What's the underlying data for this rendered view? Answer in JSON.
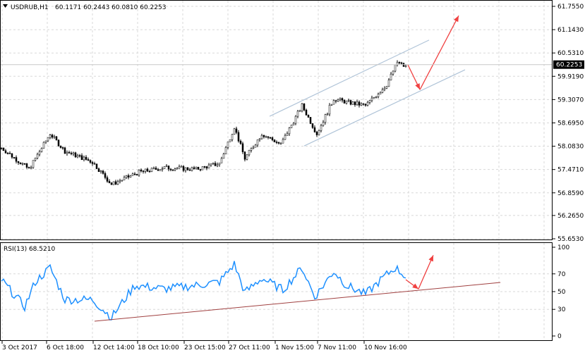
{
  "header": {
    "symbol": "USDRUB,H1",
    "ohlc": "60.1171 60.2443 60.0810 60.2253"
  },
  "chart_data": [
    {
      "type": "candlestick",
      "title": "USDRUB,H1",
      "ylim": [
        55.653,
        61.755
      ],
      "y_ticks": [
        "61.7550",
        "61.1430",
        "60.5310",
        "59.9190",
        "59.3070",
        "58.6950",
        "58.0830",
        "57.4710",
        "56.8590",
        "56.2650",
        "55.6530"
      ],
      "y_tick_values": [
        61.755,
        61.143,
        60.531,
        59.919,
        59.307,
        58.695,
        58.083,
        57.471,
        56.859,
        56.265,
        55.653
      ],
      "current_price": "60.2253",
      "current_value": 60.2253,
      "x_labels": [
        "3 Oct 2017",
        "6 Oct 18:00",
        "12 Oct 14:00",
        "18 Oct 10:00",
        "23 Oct 15:00",
        "27 Oct 11:00",
        "1 Nov 15:00",
        "7 Nov 11:00",
        "10 Nov 16:00"
      ],
      "x_label_bars": [
        0,
        21,
        43,
        64,
        86,
        107,
        129,
        149,
        171
      ],
      "close_keypoints": [
        [
          0,
          58.04
        ],
        [
          13,
          57.48
        ],
        [
          23,
          58.41
        ],
        [
          30,
          57.95
        ],
        [
          43,
          57.67
        ],
        [
          52,
          57.08
        ],
        [
          65,
          57.4
        ],
        [
          77,
          57.52
        ],
        [
          92,
          57.48
        ],
        [
          103,
          57.63
        ],
        [
          110,
          58.59
        ],
        [
          115,
          57.76
        ],
        [
          123,
          58.41
        ],
        [
          132,
          58.13
        ],
        [
          142,
          59.15
        ],
        [
          149,
          58.41
        ],
        [
          157,
          59.33
        ],
        [
          163,
          59.24
        ],
        [
          172,
          59.15
        ],
        [
          182,
          59.7
        ],
        [
          187,
          60.29
        ],
        [
          191,
          60.16
        ]
      ],
      "channel_lines": [
        [
          [
            126.7,
            58.87
          ],
          [
            202,
            60.87
          ]
        ],
        [
          [
            143,
            58.09
          ],
          [
            219,
            60.09
          ]
        ]
      ],
      "arrows": [
        [
          [
            192,
            60.22
          ],
          [
            197.7,
            59.57
          ]
        ],
        [
          [
            197.7,
            59.57
          ],
          [
            216,
            61.51
          ]
        ]
      ]
    },
    {
      "type": "line",
      "title": "RSI(13) 68.5210",
      "ylim": [
        0,
        100
      ],
      "y_ticks": [
        "100",
        "70",
        "50",
        "30",
        "0"
      ],
      "y_tick_values": [
        100,
        70,
        50,
        30,
        0
      ],
      "keypoints": [
        [
          0,
          63
        ],
        [
          11,
          33
        ],
        [
          16,
          61
        ],
        [
          23,
          77
        ],
        [
          30,
          41
        ],
        [
          43,
          41
        ],
        [
          52,
          21
        ],
        [
          63,
          57
        ],
        [
          77,
          53
        ],
        [
          92,
          57
        ],
        [
          103,
          61
        ],
        [
          110,
          81
        ],
        [
          115,
          49
        ],
        [
          123,
          65
        ],
        [
          133,
          52
        ],
        [
          142,
          77
        ],
        [
          148,
          44
        ],
        [
          157,
          73
        ],
        [
          163,
          57
        ],
        [
          172,
          47
        ],
        [
          180,
          65
        ],
        [
          186,
          77
        ],
        [
          191,
          67
        ]
      ],
      "trendline": [
        [
          44,
          16.7
        ],
        [
          235.7,
          60.3
        ]
      ],
      "arrows": [
        [
          [
            191,
            63.5
          ],
          [
            197,
            53
          ]
        ],
        [
          [
            197,
            53
          ],
          [
            204,
            91
          ]
        ]
      ]
    }
  ],
  "colors": {
    "candle": "#000000",
    "rsi": "#1e90ff",
    "channel": "#b0c4d8",
    "arrow": "#f04040",
    "trend": "#a04040",
    "grid": "#d8d8d8"
  }
}
